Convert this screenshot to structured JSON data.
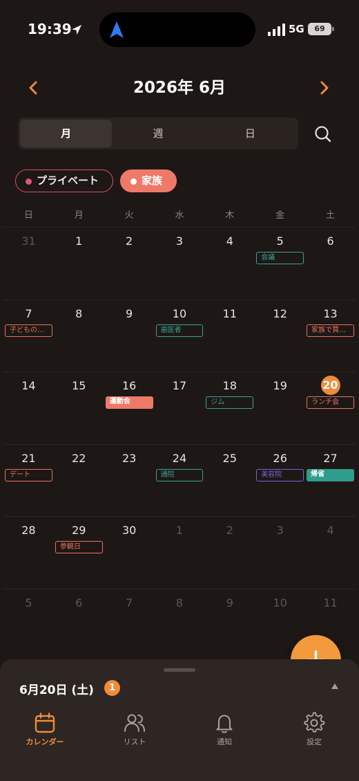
{
  "status_bar": {
    "time": "19:39",
    "network": "5G",
    "battery": "69"
  },
  "header": {
    "title": "2026年 6月",
    "prev_icon": "chevron-left-icon",
    "next_icon": "chevron-right-icon"
  },
  "view_toggle": {
    "tabs": [
      {
        "label": "月",
        "active": true
      },
      {
        "label": "週",
        "active": false
      },
      {
        "label": "日",
        "active": false
      }
    ]
  },
  "filters": [
    {
      "label": "プライベート",
      "color": "#e0557a"
    },
    {
      "label": "家族",
      "color": "#ef7968"
    }
  ],
  "weekdays": [
    "日",
    "月",
    "火",
    "水",
    "木",
    "金",
    "土"
  ],
  "weeks": [
    [
      "31",
      "1",
      "2",
      "3",
      "4",
      "5",
      "6"
    ],
    [
      "7",
      "8",
      "9",
      "10",
      "11",
      "12",
      "13"
    ],
    [
      "14",
      "15",
      "16",
      "17",
      "18",
      "19",
      "20"
    ],
    [
      "21",
      "22",
      "23",
      "24",
      "25",
      "26",
      "27"
    ],
    [
      "28",
      "29",
      "30",
      "1",
      "2",
      "3",
      "4"
    ],
    [
      "5",
      "6",
      "7",
      "8",
      "9",
      "10",
      "11"
    ]
  ],
  "events": [
    {
      "week": 0,
      "day": 5,
      "label": "会議",
      "color": "#3aa391",
      "style": "outline"
    },
    {
      "week": 1,
      "day": 0,
      "label": "子どもの…",
      "color": "#e8725f",
      "style": "outline"
    },
    {
      "week": 1,
      "day": 3,
      "label": "歯医者",
      "color": "#3aa391",
      "style": "outline"
    },
    {
      "week": 1,
      "day": 6,
      "label": "家族で買…",
      "color": "#e8725f",
      "style": "outline"
    },
    {
      "week": 2,
      "day": 2,
      "label": "運動会",
      "color": "#ef7968",
      "style": "fill"
    },
    {
      "week": 2,
      "day": 4,
      "label": "ジム",
      "color": "#3aa391",
      "style": "outline"
    },
    {
      "week": 2,
      "day": 6,
      "label": "ランチ会",
      "color": "#e8725f",
      "style": "outline"
    },
    {
      "week": 3,
      "day": 0,
      "label": "デート",
      "color": "#e8725f",
      "style": "outline"
    },
    {
      "week": 3,
      "day": 3,
      "label": "通院",
      "color": "#3aa391",
      "style": "outline"
    },
    {
      "week": 3,
      "day": 5,
      "label": "美容院",
      "color": "#7a64d6",
      "style": "outline"
    },
    {
      "week": 3,
      "day": 6,
      "label": "帰省",
      "color": "#2f9c8c",
      "style": "fill"
    },
    {
      "week": 4,
      "day": 1,
      "label": "参観日",
      "color": "#e8725f",
      "style": "outline"
    }
  ],
  "today": {
    "week": 2,
    "day": 6
  },
  "sheet": {
    "date_label": "6月20日 (土)",
    "count": "1"
  },
  "tabs": [
    {
      "label": "カレンダー",
      "icon": "calendar-icon",
      "active": true
    },
    {
      "label": "リスト",
      "icon": "people-icon",
      "active": false
    },
    {
      "label": "通知",
      "icon": "bell-icon",
      "active": false
    },
    {
      "label": "設定",
      "icon": "gear-icon",
      "active": false
    }
  ],
  "colors": {
    "accent": "#ef8c3a",
    "background": "#1d1816",
    "sheet": "#2d2623"
  }
}
